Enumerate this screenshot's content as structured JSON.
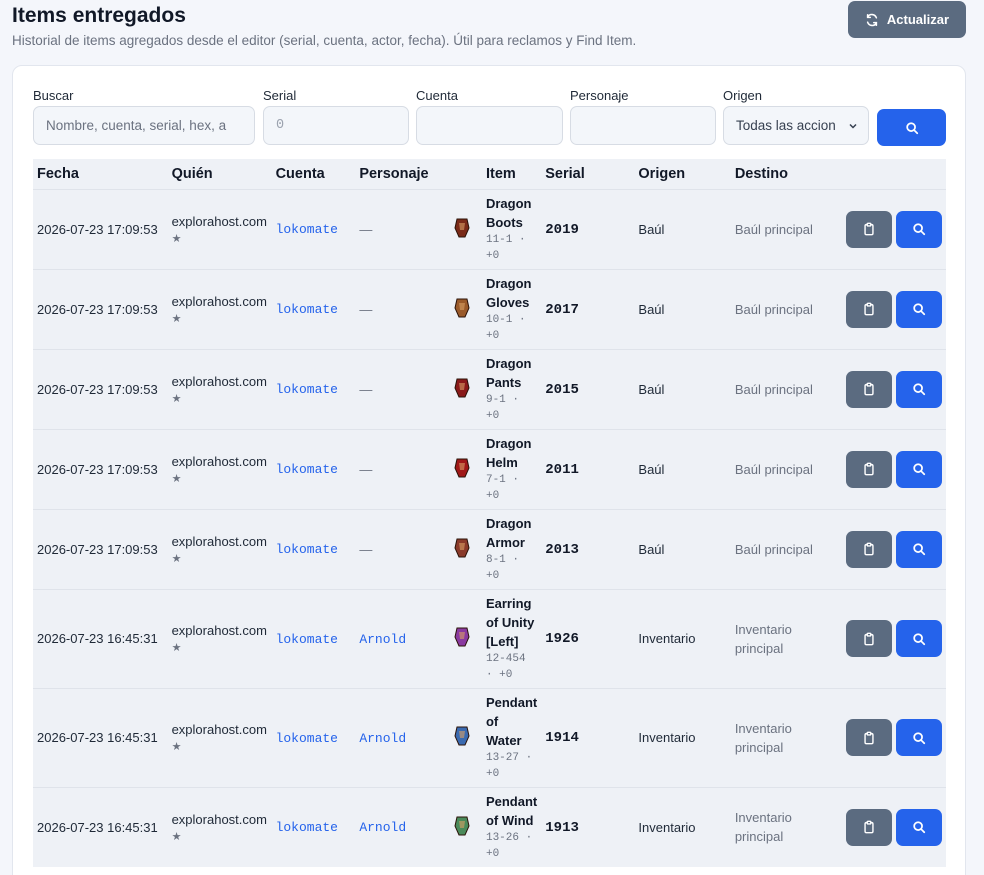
{
  "header": {
    "title": "Items entregados",
    "subtitle": "Historial de items agregados desde el editor (serial, cuenta, actor, fecha). Útil para reclamos y Find Item.",
    "refresh_label": "Actualizar"
  },
  "filters": {
    "buscar_label": "Buscar",
    "buscar_placeholder": "Nombre, cuenta, serial, hex, a",
    "serial_label": "Serial",
    "serial_placeholder": "0",
    "cuenta_label": "Cuenta",
    "personaje_label": "Personaje",
    "origen_label": "Origen",
    "origen_value": "Todas las accion"
  },
  "table": {
    "headers": [
      "Fecha",
      "Quién",
      "Cuenta",
      "Personaje",
      "Item",
      "Serial",
      "Origen",
      "Destino"
    ],
    "rows": [
      {
        "fecha": "2026-07-23 17:09:53",
        "quien": "explorahost.com",
        "cuenta": "lokomate",
        "personaje": "—",
        "item_l1": "Dragon",
        "item_l2": "Boots",
        "meta_l1": "11-1 ·",
        "meta_l2": "+0",
        "serial": "2019",
        "origen": "Baúl",
        "destino_l1": "Baúl principal",
        "destino_l2": "",
        "icon": "dragon-boots-icon",
        "color": "#7a2a18"
      },
      {
        "fecha": "2026-07-23 17:09:53",
        "quien": "explorahost.com",
        "cuenta": "lokomate",
        "personaje": "—",
        "item_l1": "Dragon",
        "item_l2": "Gloves",
        "meta_l1": "10-1 ·",
        "meta_l2": "+0",
        "serial": "2017",
        "origen": "Baúl",
        "destino_l1": "Baúl principal",
        "destino_l2": "",
        "icon": "dragon-gloves-icon",
        "color": "#9a5a2a"
      },
      {
        "fecha": "2026-07-23 17:09:53",
        "quien": "explorahost.com",
        "cuenta": "lokomate",
        "personaje": "—",
        "item_l1": "Dragon",
        "item_l2": "Pants",
        "meta_l1": "9-1 ·",
        "meta_l2": "+0",
        "serial": "2015",
        "origen": "Baúl",
        "destino_l1": "Baúl principal",
        "destino_l2": "",
        "icon": "dragon-pants-icon",
        "color": "#8a1a1a"
      },
      {
        "fecha": "2026-07-23 17:09:53",
        "quien": "explorahost.com",
        "cuenta": "lokomate",
        "personaje": "—",
        "item_l1": "Dragon",
        "item_l2": "Helm",
        "meta_l1": "7-1 ·",
        "meta_l2": "+0",
        "serial": "2011",
        "origen": "Baúl",
        "destino_l1": "Baúl principal",
        "destino_l2": "",
        "icon": "dragon-helm-icon",
        "color": "#a01818"
      },
      {
        "fecha": "2026-07-23 17:09:53",
        "quien": "explorahost.com",
        "cuenta": "lokomate",
        "personaje": "—",
        "item_l1": "Dragon",
        "item_l2": "Armor",
        "meta_l1": "8-1 ·",
        "meta_l2": "+0",
        "serial": "2013",
        "origen": "Baúl",
        "destino_l1": "Baúl principal",
        "destino_l2": "",
        "icon": "dragon-armor-icon",
        "color": "#8a3a2a"
      },
      {
        "fecha": "2026-07-23 16:45:31",
        "quien": "explorahost.com",
        "cuenta": "lokomate",
        "personaje": "Arnold",
        "item_l1": "Earring",
        "item_l2": "of Unity",
        "item_l3": "[Left]",
        "meta_l1": "12-454",
        "meta_l2": "· +0",
        "serial": "1926",
        "origen": "Inventario",
        "destino_l1": "Inventario",
        "destino_l2": "principal",
        "icon": "earring-icon",
        "color": "#8a3aa0"
      },
      {
        "fecha": "2026-07-23 16:45:31",
        "quien": "explorahost.com",
        "cuenta": "lokomate",
        "personaje": "Arnold",
        "item_l1": "Pendant",
        "item_l2": "of",
        "item_l3": "Water",
        "meta_l1": "13-27 ·",
        "meta_l2": "+0",
        "serial": "1914",
        "origen": "Inventario",
        "destino_l1": "Inventario",
        "destino_l2": "principal",
        "icon": "pendant-water-icon",
        "color": "#3a6ab0"
      },
      {
        "fecha": "2026-07-23 16:45:31",
        "quien": "explorahost.com",
        "cuenta": "lokomate",
        "personaje": "Arnold",
        "item_l1": "Pendant",
        "item_l2": "of Wind",
        "meta_l1": "13-26 ·",
        "meta_l2": "+0",
        "serial": "1913",
        "origen": "Inventario",
        "destino_l1": "Inventario",
        "destino_l2": "principal",
        "icon": "pendant-wind-icon",
        "color": "#4a8a5a"
      }
    ]
  }
}
